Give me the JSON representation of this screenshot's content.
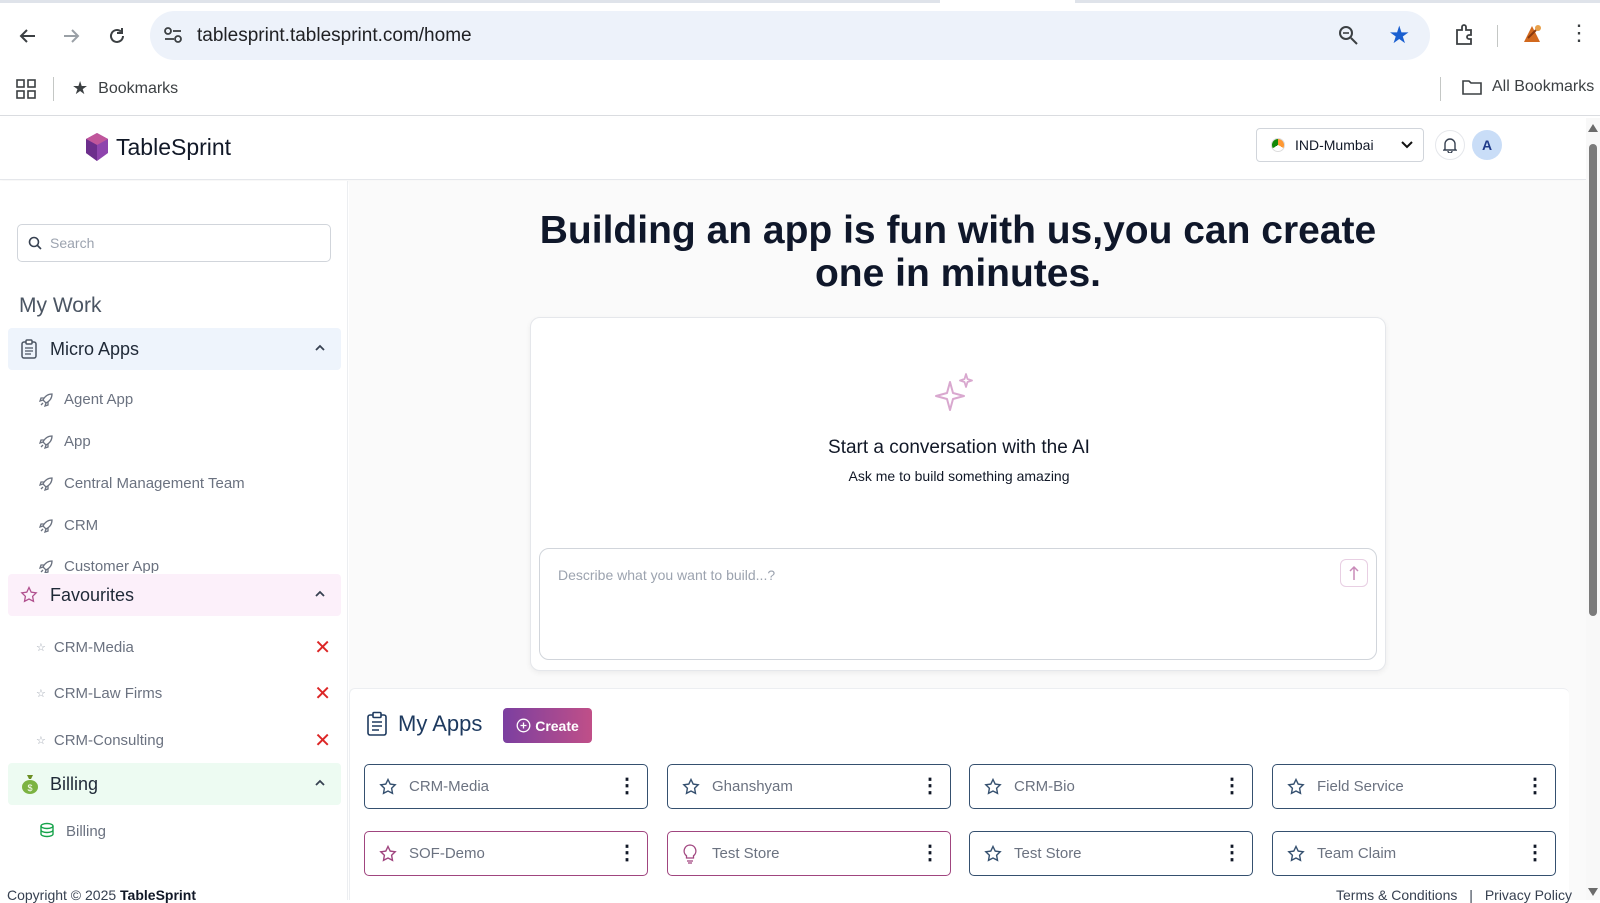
{
  "browser": {
    "url": "tablesprint.tablesprint.com/home",
    "bookmarks_label": "Bookmarks",
    "all_bookmarks_label": "All Bookmarks"
  },
  "header": {
    "brand": "TableSprint",
    "region": "IND-Mumbai",
    "avatar_initial": "A"
  },
  "sidebar": {
    "search_placeholder": "Search",
    "section_title": "My Work",
    "groups": [
      {
        "label": "Micro Apps",
        "items": [
          "Agent App",
          "App",
          "Central Management Team",
          "CRM",
          "Customer App"
        ]
      },
      {
        "label": "Favourites",
        "items": [
          "CRM-Media",
          "CRM-Law Firms",
          "CRM-Consulting"
        ]
      },
      {
        "label": "Billing",
        "items": [
          "Billing"
        ]
      }
    ],
    "copyright_prefix": "Copyright © 2025 ",
    "copyright_brand": "TableSprint"
  },
  "main": {
    "hero_line1": "Building an app is fun with us,you can create",
    "hero_line2": "one in minutes.",
    "ai_title": "Start a conversation with the AI",
    "ai_subtitle": "Ask me to build something amazing",
    "prompt_placeholder": "Describe what you want to build...?",
    "myapps_title": "My Apps",
    "create_label": "Create",
    "apps_row1": [
      "CRM-Media",
      "Ghanshyam",
      "CRM-Bio",
      "Field Service"
    ],
    "apps_row2": [
      "SOF-Demo",
      "Test Store",
      "Test Store",
      "Team Claim"
    ],
    "footer_terms": "Terms & Conditions",
    "footer_sep": "|",
    "footer_privacy": "Privacy Policy"
  },
  "colors": {
    "accent_blue": "#1a5fd0",
    "create_gradient_start": "#7b3fa0",
    "create_gradient_end": "#c04f88",
    "micro_apps_bg": "#eef4fc",
    "favourites_bg": "#fcf0fa",
    "billing_bg": "#edfbf2",
    "remove_red": "#dc2626"
  }
}
